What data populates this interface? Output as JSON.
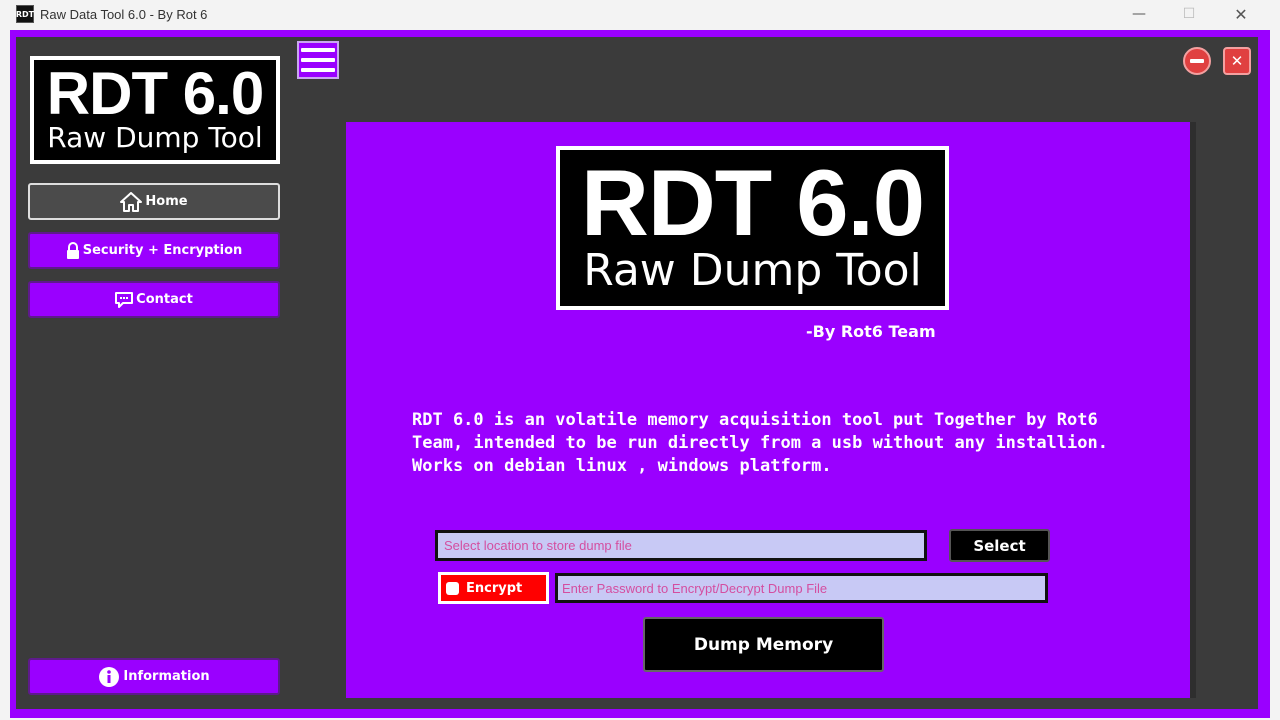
{
  "window": {
    "icon_text": "RDT",
    "title": "Raw Data Tool 6.0 - By Rot 6",
    "minimize_glyph": "—",
    "maximize_glyph": "☐",
    "close_glyph": "✕"
  },
  "sidebar": {
    "logo": {
      "big": "RDT 6.0",
      "small": "Raw Dump Tool"
    },
    "items": [
      {
        "label": "Home",
        "icon": "home-icon",
        "active": true
      },
      {
        "label": "Security + Encryption",
        "icon": "lock-icon",
        "active": false
      },
      {
        "label": "Contact",
        "icon": "chat-icon",
        "active": false
      }
    ],
    "bottom_item": {
      "label": "Information",
      "icon": "info-icon"
    }
  },
  "toolbar": {
    "menu_icon": "hamburger-icon",
    "close_glyph": "✕"
  },
  "main": {
    "hero": {
      "big": "RDT 6.0",
      "small": "Raw Dump Tool"
    },
    "byline": "-By Rot6 Team",
    "description_lines": [
      "RDT 6.0 is an volatile memory acquisition tool put Together by Rot6",
      "Team, intended to be run directly from a usb without any installion.",
      "Works on debian linux , windows platform."
    ],
    "path_input": {
      "placeholder": "Select location to store dump file",
      "value": ""
    },
    "select_label": "Select",
    "encrypt": {
      "label": "Encrypt",
      "checked": false
    },
    "password_input": {
      "placeholder": "Enter Password to Encrypt/Decrypt Dump File",
      "value": ""
    },
    "dump_label": "Dump Memory"
  },
  "colors": {
    "accent": "#9a00ff",
    "background": "#3b3b3b",
    "danger": "#ff0000",
    "input_bg": "#c8c9f5",
    "placeholder": "#d44ea0"
  }
}
